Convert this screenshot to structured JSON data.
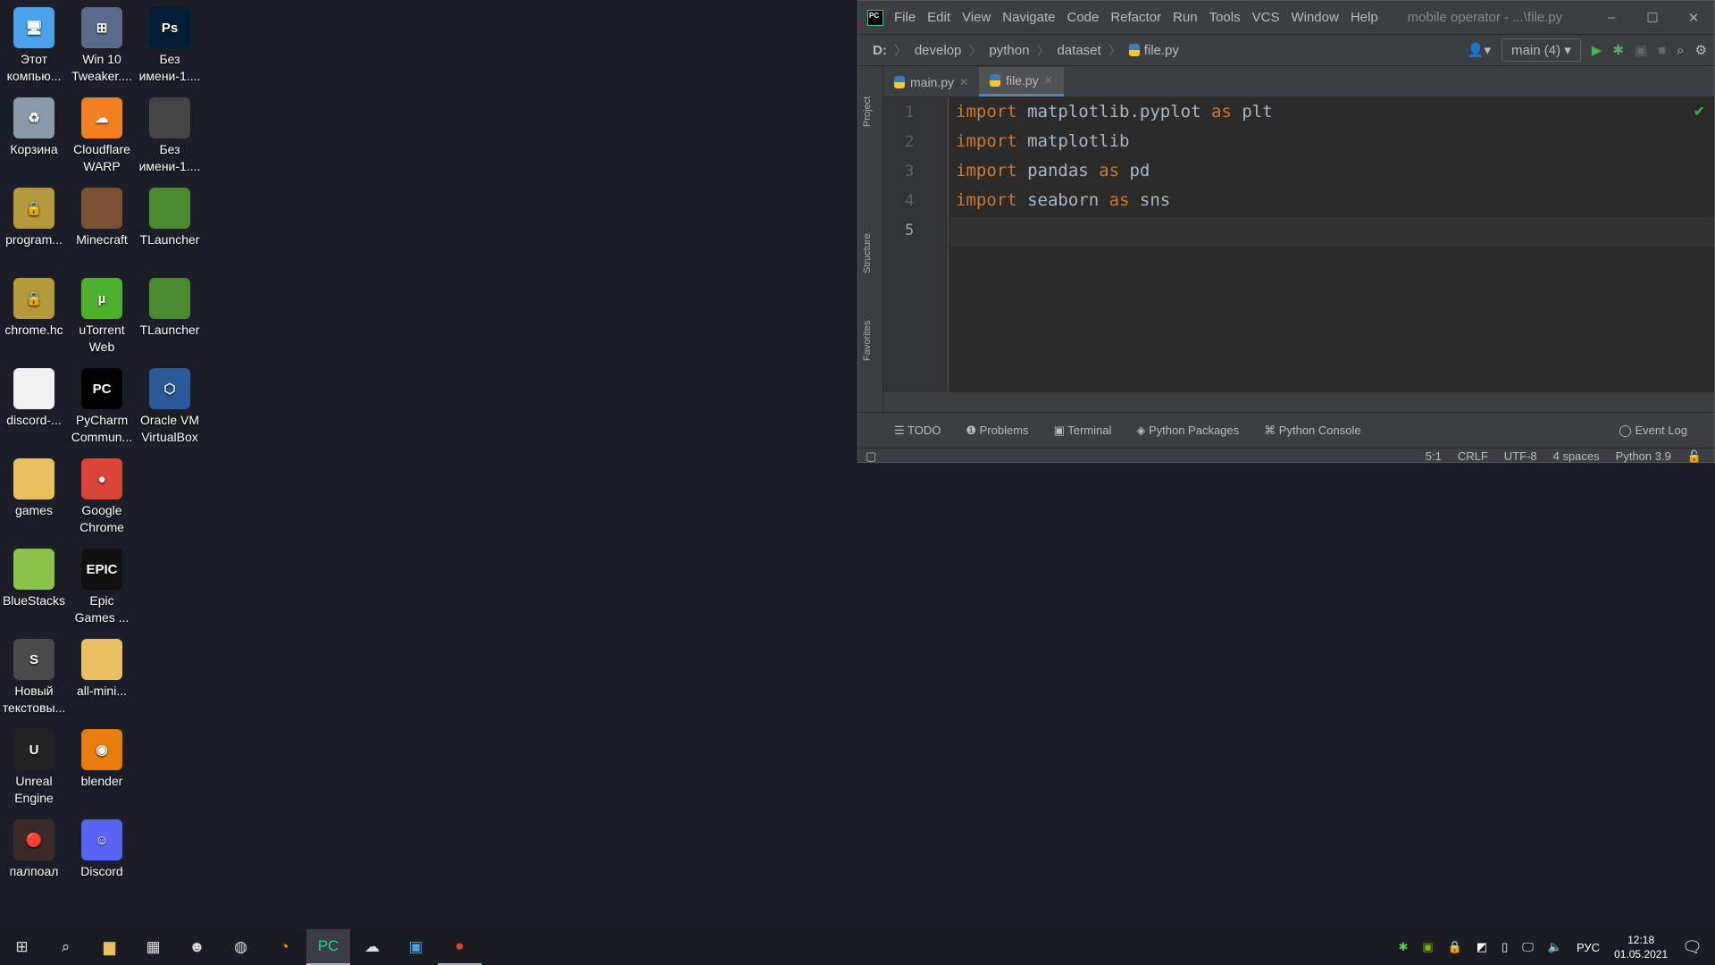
{
  "desktop": {
    "icons": [
      {
        "label": "Этот компью...",
        "col": 0,
        "row": 0,
        "icon": "computer-icon",
        "color": "#4aa3e8",
        "glyph": "🖥"
      },
      {
        "label": "Win 10 Tweaker....",
        "col": 1,
        "row": 0,
        "icon": "windows-icon",
        "color": "#5a6a8a",
        "glyph": "⊞"
      },
      {
        "label": "Без имени-1....",
        "col": 2,
        "row": 0,
        "icon": "photoshop-psd-icon",
        "color": "#001e36",
        "glyph": "Ps"
      },
      {
        "label": "Корзина",
        "col": 0,
        "row": 1,
        "icon": "recycle-bin-icon",
        "color": "#8a9aa8",
        "glyph": "♻"
      },
      {
        "label": "Cloudflare WARP",
        "col": 1,
        "row": 1,
        "icon": "cloudflare-icon",
        "color": "#f38020",
        "glyph": "☁"
      },
      {
        "label": "Без имени-1....",
        "col": 2,
        "row": 1,
        "icon": "image-thumbnail-icon",
        "color": "#444",
        "glyph": ""
      },
      {
        "label": "program...",
        "col": 0,
        "row": 2,
        "icon": "encrypted-file-icon",
        "color": "#b59a3a",
        "glyph": "🔒"
      },
      {
        "label": "Minecraft",
        "col": 1,
        "row": 2,
        "icon": "minecraft-icon",
        "color": "#7a5232",
        "glyph": ""
      },
      {
        "label": "TLauncher",
        "col": 2,
        "row": 2,
        "icon": "tlauncher-icon",
        "color": "#4b8a2e",
        "glyph": ""
      },
      {
        "label": "chrome.hc",
        "col": 0,
        "row": 3,
        "icon": "encrypted-file-icon",
        "color": "#b59a3a",
        "glyph": "🔒"
      },
      {
        "label": "uTorrent Web",
        "col": 1,
        "row": 3,
        "icon": "utorrent-icon",
        "color": "#4caf2e",
        "glyph": "µ"
      },
      {
        "label": "TLauncher",
        "col": 2,
        "row": 3,
        "icon": "tlauncher-icon",
        "color": "#4b8a2e",
        "glyph": ""
      },
      {
        "label": "discord-...",
        "col": 0,
        "row": 4,
        "icon": "blank-file-icon",
        "color": "#f0f0f0",
        "glyph": ""
      },
      {
        "label": "PyCharm Commun...",
        "col": 1,
        "row": 4,
        "icon": "pycharm-icon",
        "color": "#000",
        "glyph": "PC"
      },
      {
        "label": "Oracle VM VirtualBox",
        "col": 2,
        "row": 4,
        "icon": "virtualbox-icon",
        "color": "#2a5a9a",
        "glyph": "⬡"
      },
      {
        "label": "games",
        "col": 0,
        "row": 5,
        "icon": "folder-icon",
        "color": "#e8c060",
        "glyph": ""
      },
      {
        "label": "Google Chrome",
        "col": 1,
        "row": 5,
        "icon": "chrome-icon",
        "color": "#db4437",
        "glyph": "●"
      },
      {
        "label": "BlueStacks",
        "col": 0,
        "row": 6,
        "icon": "bluestacks-icon",
        "color": "#8bc34a",
        "glyph": ""
      },
      {
        "label": "Epic Games ...",
        "col": 1,
        "row": 6,
        "icon": "epic-games-icon",
        "color": "#111",
        "glyph": "EPIC"
      },
      {
        "label": "Новый текстовы...",
        "col": 0,
        "row": 7,
        "icon": "sublime-text-icon",
        "color": "#4a4a4a",
        "glyph": "S"
      },
      {
        "label": "all-mini...",
        "col": 1,
        "row": 7,
        "icon": "folder-icon",
        "color": "#e8c060",
        "glyph": ""
      },
      {
        "label": "Unreal Engine",
        "col": 0,
        "row": 8,
        "icon": "unreal-engine-icon",
        "color": "#222",
        "glyph": "U"
      },
      {
        "label": "blender",
        "col": 1,
        "row": 8,
        "icon": "blender-icon",
        "color": "#e87d0d",
        "glyph": "◉"
      },
      {
        "label": "палпоал",
        "col": 0,
        "row": 9,
        "icon": "record-icon",
        "color": "#3a2a2a",
        "glyph": "🔴"
      },
      {
        "label": "Discord",
        "col": 1,
        "row": 9,
        "icon": "discord-icon",
        "color": "#5865f2",
        "glyph": "☺"
      }
    ]
  },
  "ide": {
    "menu": [
      "File",
      "Edit",
      "View",
      "Navigate",
      "Code",
      "Refactor",
      "Run",
      "Tools",
      "VCS",
      "Window",
      "Help"
    ],
    "title": "mobile operator - ...\\file.py",
    "breadcrumb": [
      "D:",
      "develop",
      "python",
      "dataset",
      "file.py"
    ],
    "run_config": "main (4)",
    "side_tabs": [
      "Project",
      "Structure",
      "Favorites"
    ],
    "tabs": [
      {
        "label": "main.py",
        "active": false
      },
      {
        "label": "file.py",
        "active": true
      }
    ],
    "lines": [
      [
        [
          "kw",
          "import"
        ],
        [
          "t",
          " matplotlib.pyplot "
        ],
        [
          "kw",
          "as"
        ],
        [
          "t",
          " plt"
        ]
      ],
      [
        [
          "kw",
          "import"
        ],
        [
          "t",
          " matplotlib"
        ]
      ],
      [
        [
          "kw",
          "import"
        ],
        [
          "t",
          " pandas "
        ],
        [
          "kw",
          "as"
        ],
        [
          "t",
          " pd"
        ]
      ],
      [
        [
          "kw",
          "import"
        ],
        [
          "t",
          " seaborn "
        ],
        [
          "kw",
          "as"
        ],
        [
          "t",
          " sns"
        ]
      ],
      []
    ],
    "tool_windows": [
      "TODO",
      "Problems",
      "Terminal",
      "Python Packages",
      "Python Console"
    ],
    "event_log": "Event Log",
    "status": {
      "position": "5:1",
      "line_sep": "CRLF",
      "encoding": "UTF-8",
      "indent": "4 spaces",
      "interpreter": "Python 3.9"
    }
  },
  "taskbar": {
    "lang": "РУС",
    "time": "12:18",
    "date": "01.05.2021"
  }
}
